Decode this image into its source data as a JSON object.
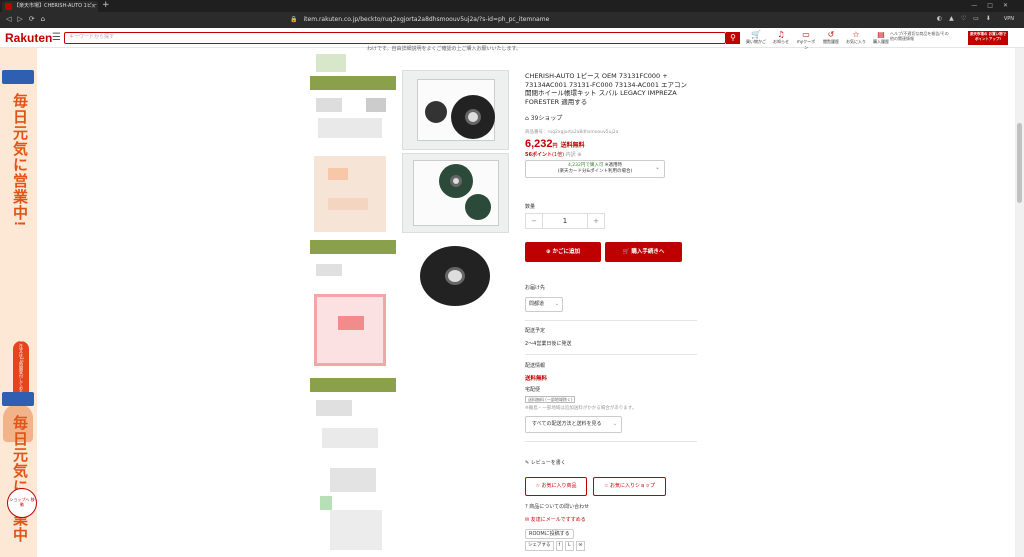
{
  "browser": {
    "tab_title": "【楽天市場】CHERISH-AUTO 1ピー",
    "url": "item.rakuten.co.jp/beckto/ruq2xgjorta2a8dhsmoouv5uj2a/?s-id=ph_pc_itemname",
    "vpn_label": "VPN"
  },
  "header": {
    "logo": "Rakuten",
    "search_placeholder": "キーワードから探す",
    "nav": [
      {
        "icon": "cart-icon",
        "label": "買い物かご"
      },
      {
        "icon": "bell-icon",
        "label": "お知らせ"
      },
      {
        "icon": "coupon-icon",
        "label": "myクーポン"
      },
      {
        "icon": "history-icon",
        "label": "閲覧履歴"
      },
      {
        "icon": "star-icon",
        "label": "お気に入り"
      },
      {
        "icon": "receipt-icon",
        "label": "購入履歴"
      }
    ],
    "help_text": "ヘルプ/不適切な商品を報告/その他の関連情報",
    "promo_text": "楽天市場の お買い物で ポイントアップ!"
  },
  "ad": {
    "text_top": "毎日元気に営業中!",
    "badge": "ご注文は24時間受付しております",
    "text_bottom": "毎日元気に営業中",
    "shop_badge": "ショップへ 移動"
  },
  "product": {
    "top_text": "わけです。自由詳細説明をよくご確認の上ご購入お願いいたします。",
    "title": "CHERISH-AUTO 1ピース OEM 73131FC000 + 73134AC001 73131-FC000 73134-AC001 エアコン 開閉ホイール帳環キット スバル LEGACY IMPREZA FORESTER 適用する",
    "shop_name": "39ショップ",
    "item_no": "商品番号：ruq2xgjorta2a8dhsmoouv5uj2a",
    "price": "6,232",
    "price_unit": "円",
    "free_shipping": "送料無料",
    "points": "56ポイント",
    "points_rate": "(1倍)",
    "points_detail": "内訳 ⊕",
    "card_price": "4,232円で購入可",
    "card_suffix": "※適用時",
    "card_note": "(楽天カード分&ポイント利用の場合)",
    "qty_label": "数量",
    "qty_value": "1",
    "cart_button": "かごに追加",
    "buy_button": "購入手続きへ",
    "delivery_label": "お届け先",
    "delivery_value": "問都道",
    "schedule_label": "配送予定",
    "schedule_value": "2～4営業日後に発送",
    "ship_info_label": "配送情報",
    "ship_free": "送料無料",
    "ship_method": "宅配便",
    "ship_tag": "送料無料 (一部地域除く)",
    "ship_note": "※離島・一部地域は追加送料がかかる場合があります。",
    "ship_select": "すべての配送方法と送料を見る",
    "review": "レビューを書く",
    "fav_item": "お気に入り商品",
    "fav_shop": "お気に入りショップ",
    "inquiry": "商品についての問い合わせ",
    "mail": "友達にメールですすめる",
    "room": "ROOMに投稿する",
    "share": "シェアする"
  },
  "colors": {
    "brand": "#bf0000",
    "ad_text": "#e25416",
    "mosaic_green": "#8aa04a",
    "mosaic_pink": "#f2a6a6"
  }
}
